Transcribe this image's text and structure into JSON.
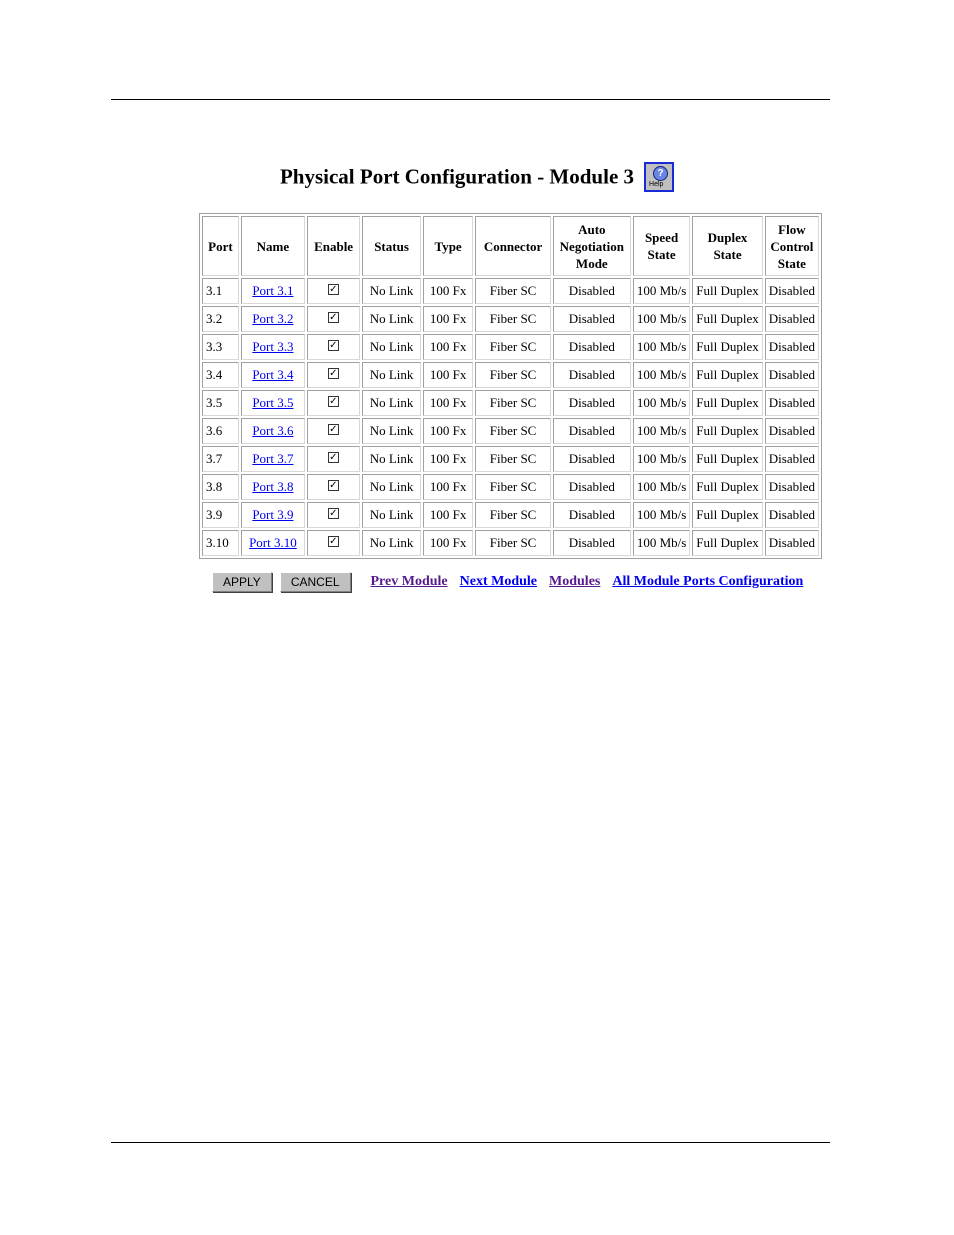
{
  "page": {
    "title": "Physical Port Configuration - Module 3",
    "help_label": "Help"
  },
  "table": {
    "headers": [
      "Port",
      "Name",
      "Enable",
      "Status",
      "Type",
      "Connector",
      "Auto Negotiation Mode",
      "Speed State",
      "Duplex State",
      "Flow Control State"
    ],
    "rows": [
      {
        "port": "3.1",
        "name": "Port 3.1",
        "enabled": true,
        "status": "No Link",
        "type": "100 Fx",
        "connector": "Fiber SC",
        "auto_neg": "Disabled",
        "speed": "100 Mb/s",
        "duplex": "Full Duplex",
        "flow": "Disabled"
      },
      {
        "port": "3.2",
        "name": "Port 3.2",
        "enabled": true,
        "status": "No Link",
        "type": "100 Fx",
        "connector": "Fiber SC",
        "auto_neg": "Disabled",
        "speed": "100 Mb/s",
        "duplex": "Full Duplex",
        "flow": "Disabled"
      },
      {
        "port": "3.3",
        "name": "Port 3.3",
        "enabled": true,
        "status": "No Link",
        "type": "100 Fx",
        "connector": "Fiber SC",
        "auto_neg": "Disabled",
        "speed": "100 Mb/s",
        "duplex": "Full Duplex",
        "flow": "Disabled"
      },
      {
        "port": "3.4",
        "name": "Port 3.4",
        "enabled": true,
        "status": "No Link",
        "type": "100 Fx",
        "connector": "Fiber SC",
        "auto_neg": "Disabled",
        "speed": "100 Mb/s",
        "duplex": "Full Duplex",
        "flow": "Disabled"
      },
      {
        "port": "3.5",
        "name": "Port 3.5",
        "enabled": true,
        "status": "No Link",
        "type": "100 Fx",
        "connector": "Fiber SC",
        "auto_neg": "Disabled",
        "speed": "100 Mb/s",
        "duplex": "Full Duplex",
        "flow": "Disabled"
      },
      {
        "port": "3.6",
        "name": "Port 3.6",
        "enabled": true,
        "status": "No Link",
        "type": "100 Fx",
        "connector": "Fiber SC",
        "auto_neg": "Disabled",
        "speed": "100 Mb/s",
        "duplex": "Full Duplex",
        "flow": "Disabled"
      },
      {
        "port": "3.7",
        "name": "Port 3.7",
        "enabled": true,
        "status": "No Link",
        "type": "100 Fx",
        "connector": "Fiber SC",
        "auto_neg": "Disabled",
        "speed": "100 Mb/s",
        "duplex": "Full Duplex",
        "flow": "Disabled"
      },
      {
        "port": "3.8",
        "name": "Port 3.8",
        "enabled": true,
        "status": "No Link",
        "type": "100 Fx",
        "connector": "Fiber SC",
        "auto_neg": "Disabled",
        "speed": "100 Mb/s",
        "duplex": "Full Duplex",
        "flow": "Disabled"
      },
      {
        "port": "3.9",
        "name": "Port 3.9",
        "enabled": true,
        "status": "No Link",
        "type": "100 Fx",
        "connector": "Fiber SC",
        "auto_neg": "Disabled",
        "speed": "100 Mb/s",
        "duplex": "Full Duplex",
        "flow": "Disabled"
      },
      {
        "port": "3.10",
        "name": "Port 3.10",
        "enabled": true,
        "status": "No Link",
        "type": "100 Fx",
        "connector": "Fiber SC",
        "auto_neg": "Disabled",
        "speed": "100 Mb/s",
        "duplex": "Full Duplex",
        "flow": "Disabled"
      }
    ]
  },
  "actions": {
    "apply": "APPLY",
    "cancel": "CANCEL",
    "links": [
      {
        "label": "Prev Module",
        "visited": true
      },
      {
        "label": "Next Module",
        "visited": false
      },
      {
        "label": "Modules",
        "visited": true
      },
      {
        "label": "All Module Ports Configuration",
        "visited": false
      }
    ]
  }
}
